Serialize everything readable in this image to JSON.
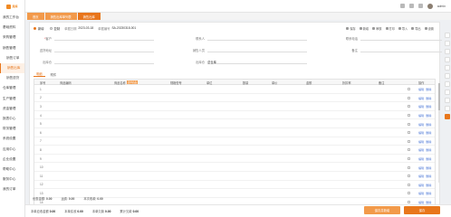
{
  "brand": {
    "name": "思库",
    "accent": "#e8761b"
  },
  "sidebar": {
    "items": [
      {
        "label": "我的工作台",
        "type": "item"
      },
      {
        "label": "基础资料",
        "type": "item"
      },
      {
        "label": "采购管理",
        "type": "item"
      },
      {
        "label": "销售管理",
        "type": "item"
      },
      {
        "label": "销售订单",
        "type": "sub"
      },
      {
        "label": "销售出库",
        "type": "sub",
        "active": true
      },
      {
        "label": "销售退货",
        "type": "sub"
      },
      {
        "label": "仓库管理",
        "type": "item"
      },
      {
        "label": "生产管理",
        "type": "item"
      },
      {
        "label": "资金管理",
        "type": "item"
      },
      {
        "label": "报表中心",
        "type": "item"
      },
      {
        "label": "财务管理",
        "type": "item"
      },
      {
        "label": "系统设置",
        "type": "item"
      },
      {
        "label": "应用中心",
        "type": "item"
      },
      {
        "label": "企业设置",
        "type": "item"
      },
      {
        "label": "帮助中心",
        "type": "item"
      },
      {
        "label": "服务中心",
        "type": "item"
      },
      {
        "label": "我的订单",
        "type": "item"
      }
    ]
  },
  "topbar": {
    "user": "admin"
  },
  "tabs": [
    {
      "label": "首页",
      "active": false
    },
    {
      "label": "销售出库单列表",
      "active": false
    },
    {
      "label": "销售出库",
      "active": true
    }
  ],
  "header": {
    "mode_a": "新增",
    "mode_b": "复制",
    "date_label": "单据日期",
    "date_value": "2023-03-18",
    "no_label": "单据编号",
    "no_value": "SA-20230318-001"
  },
  "toolbar": [
    "保存",
    "新增",
    "审核",
    "打印",
    "导入",
    "导出",
    "设置"
  ],
  "form": {
    "customer_label": "客户",
    "contact_label": "联系人",
    "phone_label": "联系电话",
    "address_label": "送货地址",
    "salesman_label": "销售人员",
    "remark_label": "备注",
    "warehouse_label": "出库仓",
    "warehouse_value": "总仓库"
  },
  "sub_tabs": [
    "明细",
    "附件"
  ],
  "grid": {
    "columns": [
      "序号",
      "商品编码",
      "商品名称",
      "规格型号",
      "单位",
      "数量",
      "单价",
      "金额",
      "折扣率",
      "备注",
      "操作"
    ],
    "tag": "选择商品",
    "rows": [
      "1",
      "2",
      "3",
      "4",
      "5",
      "6",
      "7",
      "8",
      "9",
      "10",
      "11",
      "12",
      "13",
      "14"
    ],
    "action_a": "编辑",
    "action_b": "删除",
    "total_label": "合计",
    "total_qty": "0.000000",
    "total_amount": "0.00",
    "total_right": "0.00"
  },
  "amounts": {
    "discount_label": "优惠金额",
    "discount_value": "0.00",
    "freight_label": "运费",
    "freight_value": "0.00",
    "paid_label": "本次收款",
    "paid_value": "0.00"
  },
  "footer": [
    {
      "label": "本单应收金额",
      "value": "0.00"
    },
    {
      "label": "本单实收",
      "value": "0.00"
    },
    {
      "label": "本单欠款",
      "value": "0.00"
    },
    {
      "label": "累计欠款",
      "value": "0.00"
    }
  ],
  "buttons": {
    "save_new": "保存并新增",
    "save": "保存"
  },
  "colors": {
    "orange": "#e8761b",
    "light_orange": "#f29a4a",
    "link": "#4a76d6"
  }
}
